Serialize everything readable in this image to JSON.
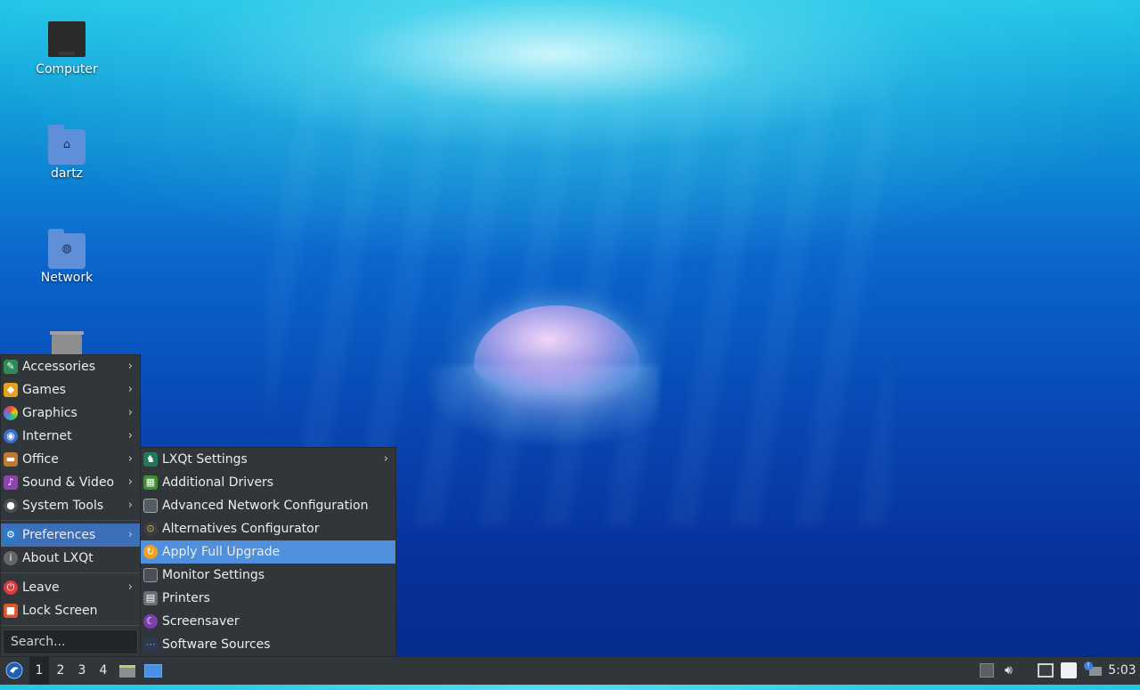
{
  "desktop": {
    "icons": [
      {
        "label": "Computer",
        "icon": "computer-icon"
      },
      {
        "label": "dartz",
        "icon": "home-folder-icon"
      },
      {
        "label": "Network",
        "icon": "network-folder-icon"
      },
      {
        "label": "",
        "icon": "trash-icon"
      }
    ]
  },
  "main_menu": {
    "categories": [
      {
        "label": "Accessories",
        "icon": "accessories-icon",
        "has_submenu": true
      },
      {
        "label": "Games",
        "icon": "games-icon",
        "has_submenu": true
      },
      {
        "label": "Graphics",
        "icon": "graphics-icon",
        "has_submenu": true
      },
      {
        "label": "Internet",
        "icon": "internet-icon",
        "has_submenu": true
      },
      {
        "label": "Office",
        "icon": "office-icon",
        "has_submenu": true
      },
      {
        "label": "Sound & Video",
        "icon": "sound-video-icon",
        "has_submenu": true
      },
      {
        "label": "System Tools",
        "icon": "system-tools-icon",
        "has_submenu": true
      }
    ],
    "preferences": {
      "label": "Preferences",
      "icon": "preferences-icon"
    },
    "about": {
      "label": "About LXQt",
      "icon": "about-icon"
    },
    "leave": {
      "label": "Leave",
      "icon": "power-icon"
    },
    "lock": {
      "label": "Lock Screen",
      "icon": "lock-icon"
    },
    "search": {
      "placeholder": "Search..."
    }
  },
  "preferences_submenu": {
    "items": [
      {
        "label": "LXQt Settings",
        "icon": "lxqt-settings-icon",
        "has_submenu": true
      },
      {
        "label": "Additional Drivers",
        "icon": "drivers-icon"
      },
      {
        "label": "Advanced Network Configuration",
        "icon": "network-config-icon"
      },
      {
        "label": "Alternatives Configurator",
        "icon": "alternatives-icon"
      },
      {
        "label": "Apply Full Upgrade",
        "icon": "upgrade-icon",
        "highlighted": true
      },
      {
        "label": "Monitor Settings",
        "icon": "monitor-icon"
      },
      {
        "label": "Printers",
        "icon": "printer-icon"
      },
      {
        "label": "Screensaver",
        "icon": "screensaver-icon"
      },
      {
        "label": "Software Sources",
        "icon": "software-sources-icon"
      }
    ]
  },
  "taskbar": {
    "workspaces": [
      "1",
      "2",
      "3",
      "4"
    ],
    "active_workspace": "1",
    "clock": "5:03"
  },
  "colors": {
    "menu_bg": "#31363b",
    "selected_bg": "#3d6fb6",
    "highlight_bg": "#4f8fdb"
  }
}
